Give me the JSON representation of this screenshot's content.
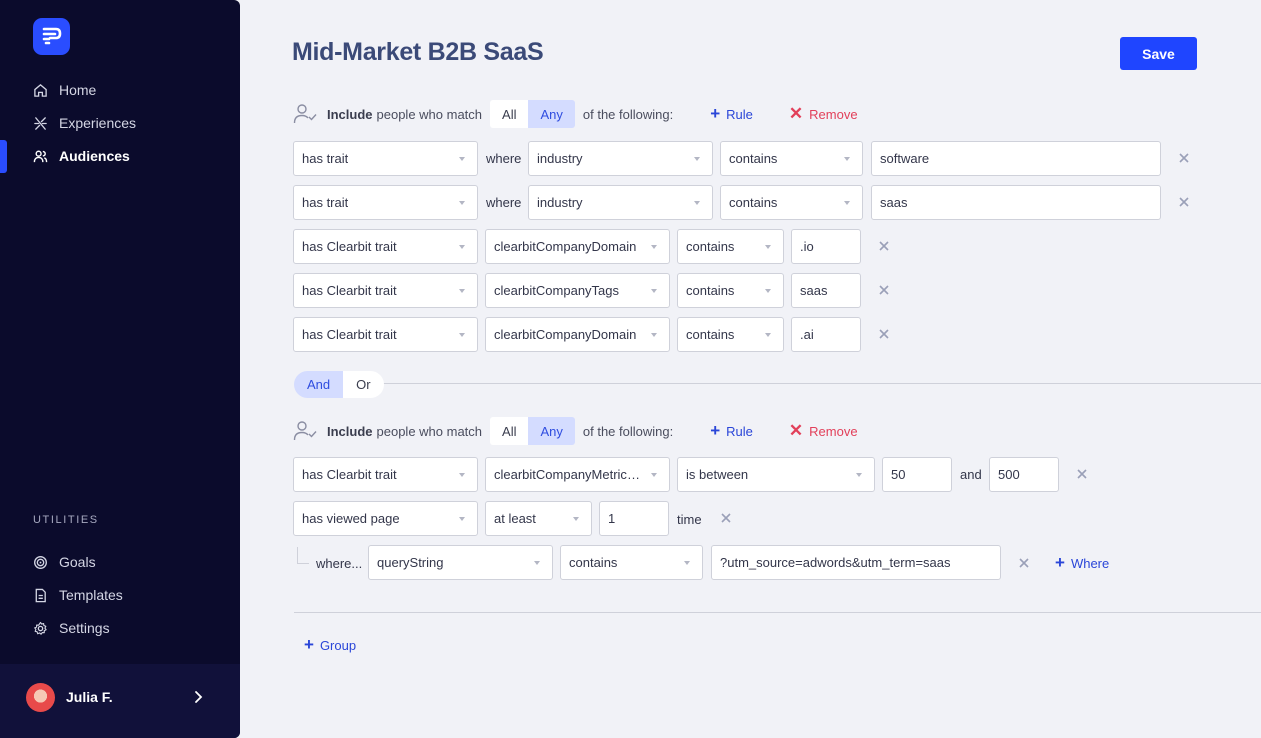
{
  "sidebar": {
    "nav": [
      {
        "label": "Home",
        "icon": "home-icon"
      },
      {
        "label": "Experiences",
        "icon": "experiences-icon"
      },
      {
        "label": "Audiences",
        "icon": "audiences-icon",
        "active": true
      }
    ],
    "utilities_title": "UTILITIES",
    "utilities": [
      {
        "label": "Goals",
        "icon": "target-icon"
      },
      {
        "label": "Templates",
        "icon": "document-icon"
      },
      {
        "label": "Settings",
        "icon": "gear-icon"
      }
    ],
    "user": {
      "name": "Julia F."
    }
  },
  "header": {
    "title": "Mid-Market B2B SaaS",
    "save_label": "Save"
  },
  "group_header": {
    "include": "Include",
    "match_text": "people who match",
    "all": "All",
    "any": "Any",
    "following": "of the following:",
    "rule": "Rule",
    "remove": "Remove"
  },
  "group1": {
    "rows": [
      {
        "type": "has trait",
        "where": "where",
        "key": "industry",
        "op": "contains",
        "value": "software"
      },
      {
        "type": "has trait",
        "where": "where",
        "key": "industry",
        "op": "contains",
        "value": "saas"
      },
      {
        "type": "has Clearbit trait",
        "key": "clearbitCompanyDomain",
        "op": "contains",
        "value": ".io"
      },
      {
        "type": "has Clearbit trait",
        "key": "clearbitCompanyTags",
        "op": "contains",
        "value": "saas"
      },
      {
        "type": "has Clearbit trait",
        "key": "clearbitCompanyDomain",
        "op": "contains",
        "value": ".ai"
      }
    ]
  },
  "combinator": {
    "and": "And",
    "or": "Or"
  },
  "group2": {
    "row1": {
      "type": "has Clearbit trait",
      "key": "clearbitCompanyMetrics...",
      "op": "is between",
      "min": "50",
      "and": "and",
      "max": "500"
    },
    "row2": {
      "type": "has viewed page",
      "op": "at least",
      "count": "1",
      "unit": "time"
    },
    "row3": {
      "where": "where...",
      "key": "queryString",
      "op": "contains",
      "value": "?utm_source=adwords&utm_term=saas",
      "add_where": "Where"
    }
  },
  "add_group": "Group"
}
